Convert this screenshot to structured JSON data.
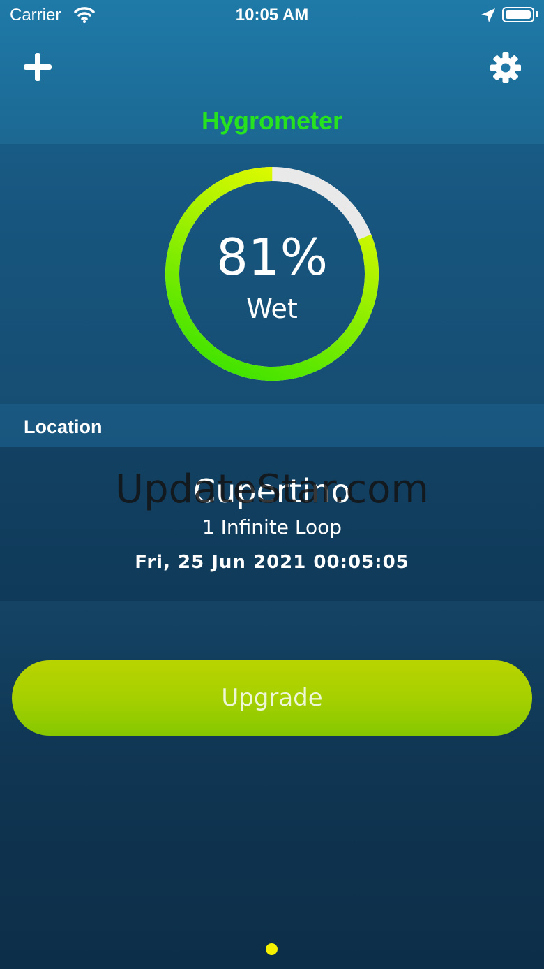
{
  "status_bar": {
    "carrier": "Carrier",
    "time": "10:05 AM",
    "icons": [
      "wifi-icon",
      "location-arrow-icon",
      "battery-icon"
    ]
  },
  "nav": {
    "title": "Hygrometer",
    "title_color": "#27e21f",
    "left_icon": "plus-icon",
    "right_icon": "gear-icon"
  },
  "gauge": {
    "value": "81%",
    "label": "Wet",
    "fill_fraction": 0.81,
    "colors": {
      "start": "#29e000",
      "end": "#ffff00",
      "track": "#e9e9e9"
    }
  },
  "location": {
    "header": "Location",
    "city": "Cupertino",
    "address": "1 Infinite Loop",
    "datetime": "Fri, 25 Jun 2021 00:05:05"
  },
  "watermark": "UpdateStar.com",
  "upgrade_button": {
    "label": "Upgrade",
    "color": "#a6d000"
  },
  "pager": {
    "dot_color": "#f5f000"
  }
}
